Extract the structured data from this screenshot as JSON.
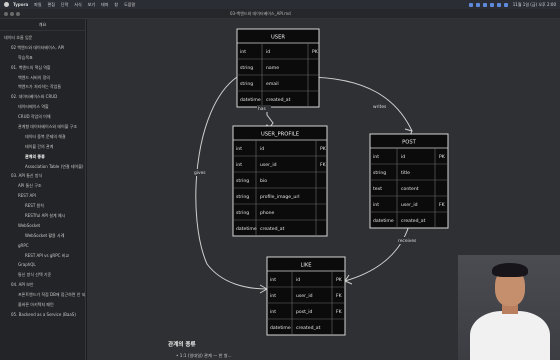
{
  "menubar": {
    "app": "Typora",
    "items": [
      "파일",
      "편집",
      "단락",
      "서식",
      "보기",
      "테마",
      "창",
      "도움말"
    ],
    "clock": "11월 1일 (금) 오후 2:00"
  },
  "window": {
    "title": "03-백엔드와 데이터베이스_API.md"
  },
  "sidebar": {
    "header": "개요",
    "items": [
      {
        "label": "데이터 흐름 입문",
        "indent": 0
      },
      {
        "label": "02 백엔드와 데이터베이스, API",
        "indent": 1
      },
      {
        "label": "학습목표",
        "indent": 2
      },
      {
        "label": "01. 백엔드의 핵심 역할",
        "indent": 1
      },
      {
        "label": "백엔드 서버의 정의",
        "indent": 2
      },
      {
        "label": "백엔드가 처리하는 작업들",
        "indent": 2
      },
      {
        "label": "02. 데이터베이스와 CRUD",
        "indent": 1
      },
      {
        "label": "데이터베이스 역할",
        "indent": 2
      },
      {
        "label": "CRUD 작업의 이해",
        "indent": 2
      },
      {
        "label": "관계형 데이터베이스와 테이블 구조",
        "indent": 2
      },
      {
        "label": "데이터 중복 문제의 해결",
        "indent": 3
      },
      {
        "label": "테이블 간의 관계",
        "indent": 3
      },
      {
        "label": "관계의 종류",
        "indent": 3,
        "active": true
      },
      {
        "label": "Association Table (연결 테이블)",
        "indent": 3
      },
      {
        "label": "03. API 통신 방식",
        "indent": 1
      },
      {
        "label": "API 통신 구조",
        "indent": 2
      },
      {
        "label": "REST API",
        "indent": 2
      },
      {
        "label": "REST 원칙",
        "indent": 3
      },
      {
        "label": "RESTful API 설계 예시",
        "indent": 3
      },
      {
        "label": "WebSocket",
        "indent": 2
      },
      {
        "label": "WebSocket 활용 사례",
        "indent": 3
      },
      {
        "label": "gRPC",
        "indent": 2
      },
      {
        "label": "REST API vs gRPC 비교",
        "indent": 3
      },
      {
        "label": "GraphQL",
        "indent": 2
      },
      {
        "label": "통신 방식 선택 기준",
        "indent": 2
      },
      {
        "label": "04. API 보안",
        "indent": 1
      },
      {
        "label": "프론트엔드가 직접 DB에 접근하면 안 되는 이유",
        "indent": 2
      },
      {
        "label": "올바른 아키텍처 패턴",
        "indent": 2
      },
      {
        "label": "05. Backend as a Service (BaaS)",
        "indent": 1
      }
    ]
  },
  "diagram": {
    "entities": {
      "user": {
        "name": "USER",
        "rows": [
          {
            "type": "int",
            "field": "id",
            "key": "PK"
          },
          {
            "type": "string",
            "field": "name",
            "key": ""
          },
          {
            "type": "string",
            "field": "email",
            "key": ""
          },
          {
            "type": "datetime",
            "field": "created_at",
            "key": ""
          }
        ]
      },
      "user_profile": {
        "name": "USER_PROFILE",
        "rows": [
          {
            "type": "int",
            "field": "id",
            "key": "PK"
          },
          {
            "type": "int",
            "field": "user_id",
            "key": "FK"
          },
          {
            "type": "string",
            "field": "bio",
            "key": ""
          },
          {
            "type": "string",
            "field": "profile_image_url",
            "key": ""
          },
          {
            "type": "string",
            "field": "phone",
            "key": ""
          },
          {
            "type": "datetime",
            "field": "created_at",
            "key": ""
          }
        ]
      },
      "post": {
        "name": "POST",
        "rows": [
          {
            "type": "int",
            "field": "id",
            "key": "PK"
          },
          {
            "type": "string",
            "field": "title",
            "key": ""
          },
          {
            "type": "text",
            "field": "content",
            "key": ""
          },
          {
            "type": "int",
            "field": "user_id",
            "key": "FK"
          },
          {
            "type": "datetime",
            "field": "created_at",
            "key": ""
          }
        ]
      },
      "like": {
        "name": "LIKE",
        "rows": [
          {
            "type": "int",
            "field": "id",
            "key": "PK"
          },
          {
            "type": "int",
            "field": "user_id",
            "key": "FK"
          },
          {
            "type": "int",
            "field": "post_id",
            "key": "FK"
          },
          {
            "type": "datetime",
            "field": "created_at",
            "key": ""
          }
        ]
      }
    },
    "relations": {
      "has": "has",
      "writes": "writes",
      "gives": "gives",
      "receives": "receives"
    }
  },
  "content": {
    "section_heading": "관계의 종류",
    "bullet": "• 1:1 (일대일) 관계 — 한 쌍..."
  },
  "colors": {
    "background": "#2f3033",
    "entity_fill": "#0b0b0b",
    "entity_border": "#d6d6d6",
    "line": "#cfcfcf"
  }
}
